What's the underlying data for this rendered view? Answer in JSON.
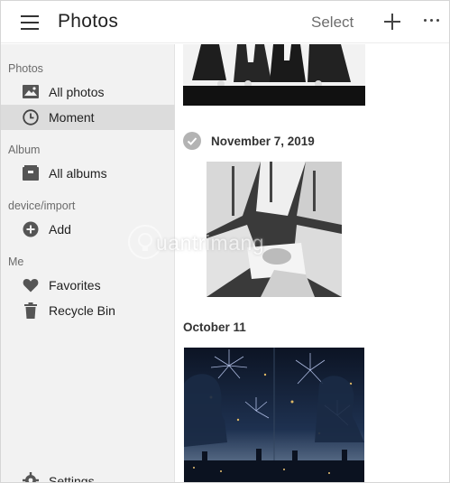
{
  "app": {
    "title": "Photos",
    "select_label": "Select"
  },
  "sidebar": {
    "sections": [
      {
        "label": "Photos"
      },
      {
        "label": "Album"
      },
      {
        "label": "device/import"
      },
      {
        "label": "Me"
      }
    ],
    "items": [
      {
        "label": "All photos",
        "icon": "image-icon"
      },
      {
        "label": "Moment",
        "icon": "clock-icon",
        "active": true
      },
      {
        "label": "All albums",
        "icon": "album-icon"
      },
      {
        "label": "Add",
        "icon": "add-circle-icon"
      },
      {
        "label": "Favorites",
        "icon": "heart-icon"
      },
      {
        "label": "Recycle Bin",
        "icon": "trash-icon"
      }
    ],
    "settings_label": "Settings"
  },
  "content": {
    "groups": [
      {
        "date": "November 7, 2019"
      },
      {
        "date": "October 11"
      }
    ]
  },
  "watermark": {
    "text": "uantrimang"
  },
  "colors": {
    "sidebar_bg": "#f2f2f2",
    "active_item": "#dcdcdc",
    "check_grey": "#b3b3b3"
  }
}
